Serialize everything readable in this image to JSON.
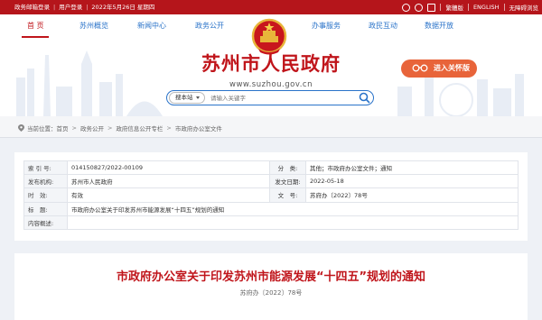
{
  "topbar": {
    "mail_login": "政务邮箱登录",
    "user_login": "用户登录",
    "date": "2022年5月26日 星期四",
    "traditional": "繁體版",
    "english": "ENGLISH",
    "accessibility": "无障碍浏览"
  },
  "nav": {
    "items": [
      "首 页",
      "苏州概览",
      "新闻中心",
      "政务公开",
      "办事服务",
      "政民互动",
      "数据开放"
    ]
  },
  "header": {
    "site_title": "苏州市人民政府",
    "site_url": "www.suzhou.gov.cn",
    "care_mode": "进入关怀版"
  },
  "search": {
    "scope": "搜本站",
    "placeholder": "请输入关键字"
  },
  "breadcrumb": {
    "label": "当前位置：",
    "items": [
      "首页",
      "政务公开",
      "政府信息公开专栏",
      "市政府办公室文件"
    ]
  },
  "info": {
    "index_label": "索 引 号:",
    "index_value": "014150827/2022-00109",
    "category_label": "分　类:",
    "category_value": "其他；市政府办公室文件；通知",
    "agency_label": "发布机构:",
    "agency_value": "苏州市人民政府",
    "date_label": "发文日期:",
    "date_value": "2022-05-18",
    "validity_label": "时　效:",
    "validity_value": "有效",
    "docno_label": "文　号:",
    "docno_value": "苏府办〔2022〕78号",
    "title_label": "标　题:",
    "title_value": "市政府办公室关于印发苏州市能源发展“十四五”规划的通知",
    "summary_label": "内容概述:",
    "summary_value": ""
  },
  "article": {
    "title": "市政府办公室关于印发苏州市能源发展“十四五”规划的通知",
    "doc_no": "苏府办〔2022〕78号"
  },
  "colors": {
    "brand_red": "#c0151b",
    "nav_blue": "#2a73c9",
    "care_orange": "#e8643a"
  }
}
